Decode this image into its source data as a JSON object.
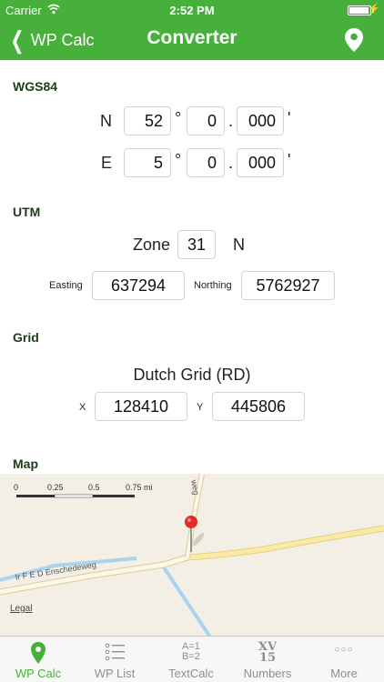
{
  "status": {
    "carrier": "Carrier",
    "time": "2:52 PM"
  },
  "nav": {
    "back_label": "WP Calc",
    "title": "Converter"
  },
  "wgs84": {
    "title": "WGS84",
    "lat": {
      "hemisphere": "N",
      "degrees": "52",
      "minutes": "0",
      "decimals": "000"
    },
    "lon": {
      "hemisphere": "E",
      "degrees": "5",
      "minutes": "0",
      "decimals": "000"
    },
    "degree_symbol": "°",
    "dot": ".",
    "minute_symbol": "'"
  },
  "utm": {
    "title": "UTM",
    "zone_label": "Zone",
    "zone": "31",
    "zone_hemisphere": "N",
    "easting_label": "Easting",
    "easting": "637294",
    "northing_label": "Northing",
    "northing": "5762927"
  },
  "grid": {
    "title": "Grid",
    "grid_name": "Dutch Grid (RD)",
    "x_label": "X",
    "x": "128410",
    "y_label": "Y",
    "y": "445806"
  },
  "map": {
    "title": "Map",
    "scale": [
      "0",
      "0.25",
      "0.5",
      "0.75 mi"
    ],
    "road_label": "Ir F E D Enschedeweg",
    "road_label_2": "weg",
    "legal": "Legal"
  },
  "tabs": [
    {
      "label": "WP Calc",
      "icon": "pin-icon"
    },
    {
      "label": "WP List",
      "icon": "list-icon"
    },
    {
      "label": "TextCalc",
      "icon": "textcalc-icon",
      "glyph1": "A=1",
      "glyph2": "B=2"
    },
    {
      "label": "Numbers",
      "icon": "numbers-icon",
      "glyph1": "XV",
      "glyph2": "15"
    },
    {
      "label": "More",
      "icon": "more-icon",
      "glyph1": "○○○"
    }
  ],
  "colors": {
    "accent": "#46b03a",
    "section": "#1d3c1a"
  }
}
